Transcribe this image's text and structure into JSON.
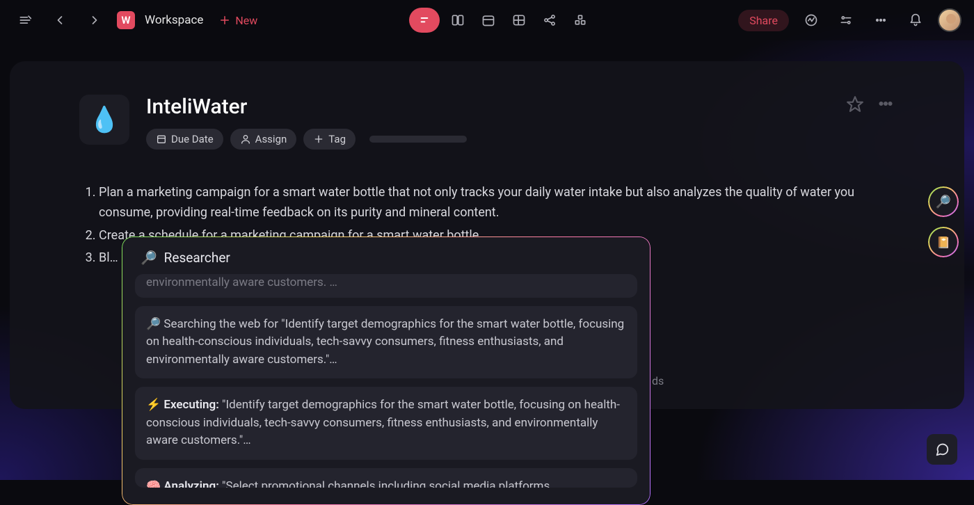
{
  "nav": {
    "workspace_initial": "W",
    "workspace_label": "Workspace",
    "new_label": "New",
    "share_label": "Share"
  },
  "doc": {
    "icon": "💧",
    "title": "InteliWater",
    "chips": {
      "due_date": "Due Date",
      "assign": "Assign",
      "tag": "Tag"
    },
    "list": [
      "Plan a marketing campaign for a smart water bottle that not only tracks your daily water intake but also analyzes the quality of water you consume, providing real-time feedback on its purity and mineral content.",
      "Create a schedule for a marketing campaign for a smart water bottle",
      "Bl… …nd tips for using a smart water bo…"
    ],
    "peek_suffix": "ds"
  },
  "researcher": {
    "title_icon": "🔎",
    "title": "Researcher",
    "messages": [
      {
        "text": "environmentally aware customers. …",
        "faded": true
      },
      {
        "text": "🔎 Searching the web for \"Identify target demographics for the smart water bottle, focusing on health-conscious individuals, tech-savvy consumers, fitness enthusiasts, and environmentally aware customers.\"…"
      },
      {
        "html": "⚡ <b>Executing:</b> \"Identify target demographics for the smart water bottle, focusing on health-conscious individuals, tech-savvy consumers, fitness enthusiasts, and environmentally aware customers.\"…"
      },
      {
        "html": "🧠 <b>Analyzing:</b> \"Select promotional channels including social media platforms",
        "cut": true
      }
    ]
  }
}
